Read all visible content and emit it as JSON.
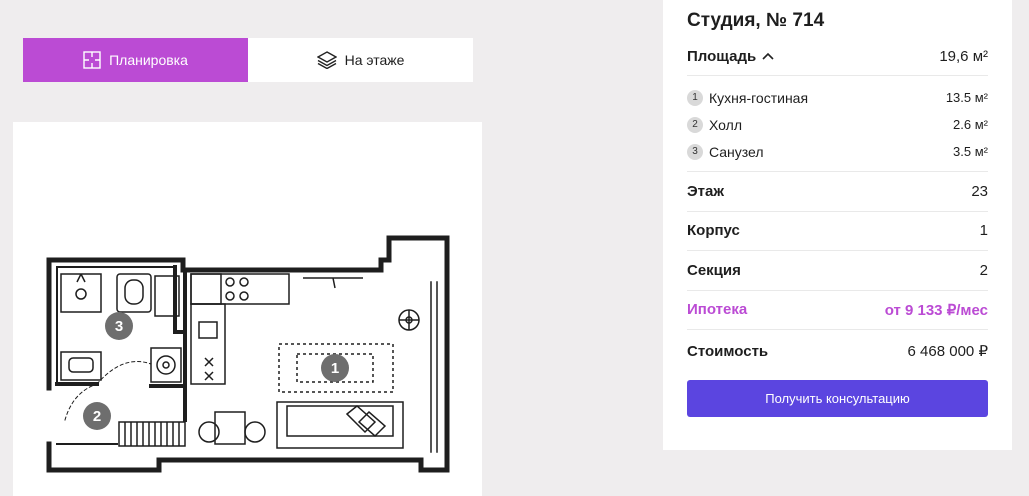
{
  "tabs": [
    {
      "label": "Планировка",
      "icon": "floorplan-icon",
      "active": true
    },
    {
      "label": "На этаже",
      "icon": "layers-icon",
      "active": false
    }
  ],
  "plan": {
    "rooms": [
      {
        "num": "1",
        "name": "Кухня-гостиная"
      },
      {
        "num": "2",
        "name": "Холл"
      },
      {
        "num": "3",
        "name": "Санузел"
      }
    ]
  },
  "card": {
    "title": "Студия, № 714",
    "area_label": "Площадь",
    "area_value": "19,6 м²",
    "rooms": [
      {
        "num": "1",
        "name": "Кухня-гостиная",
        "area": "13.5 м²"
      },
      {
        "num": "2",
        "name": "Холл",
        "area": "2.6 м²"
      },
      {
        "num": "3",
        "name": "Санузел",
        "area": "3.5 м²"
      }
    ],
    "floor_label": "Этаж",
    "floor_value": "23",
    "building_label": "Корпус",
    "building_value": "1",
    "section_label": "Секция",
    "section_value": "2",
    "mortgage_label": "Ипотека",
    "mortgage_value": "от 9 133 ₽/мес",
    "price_label": "Стоимость",
    "price_value": "6 468 000 ₽",
    "cta_label": "Получить консультацию"
  },
  "colors": {
    "accent": "#bb4bd4",
    "button": "#5b45e0",
    "background": "#efedee"
  }
}
